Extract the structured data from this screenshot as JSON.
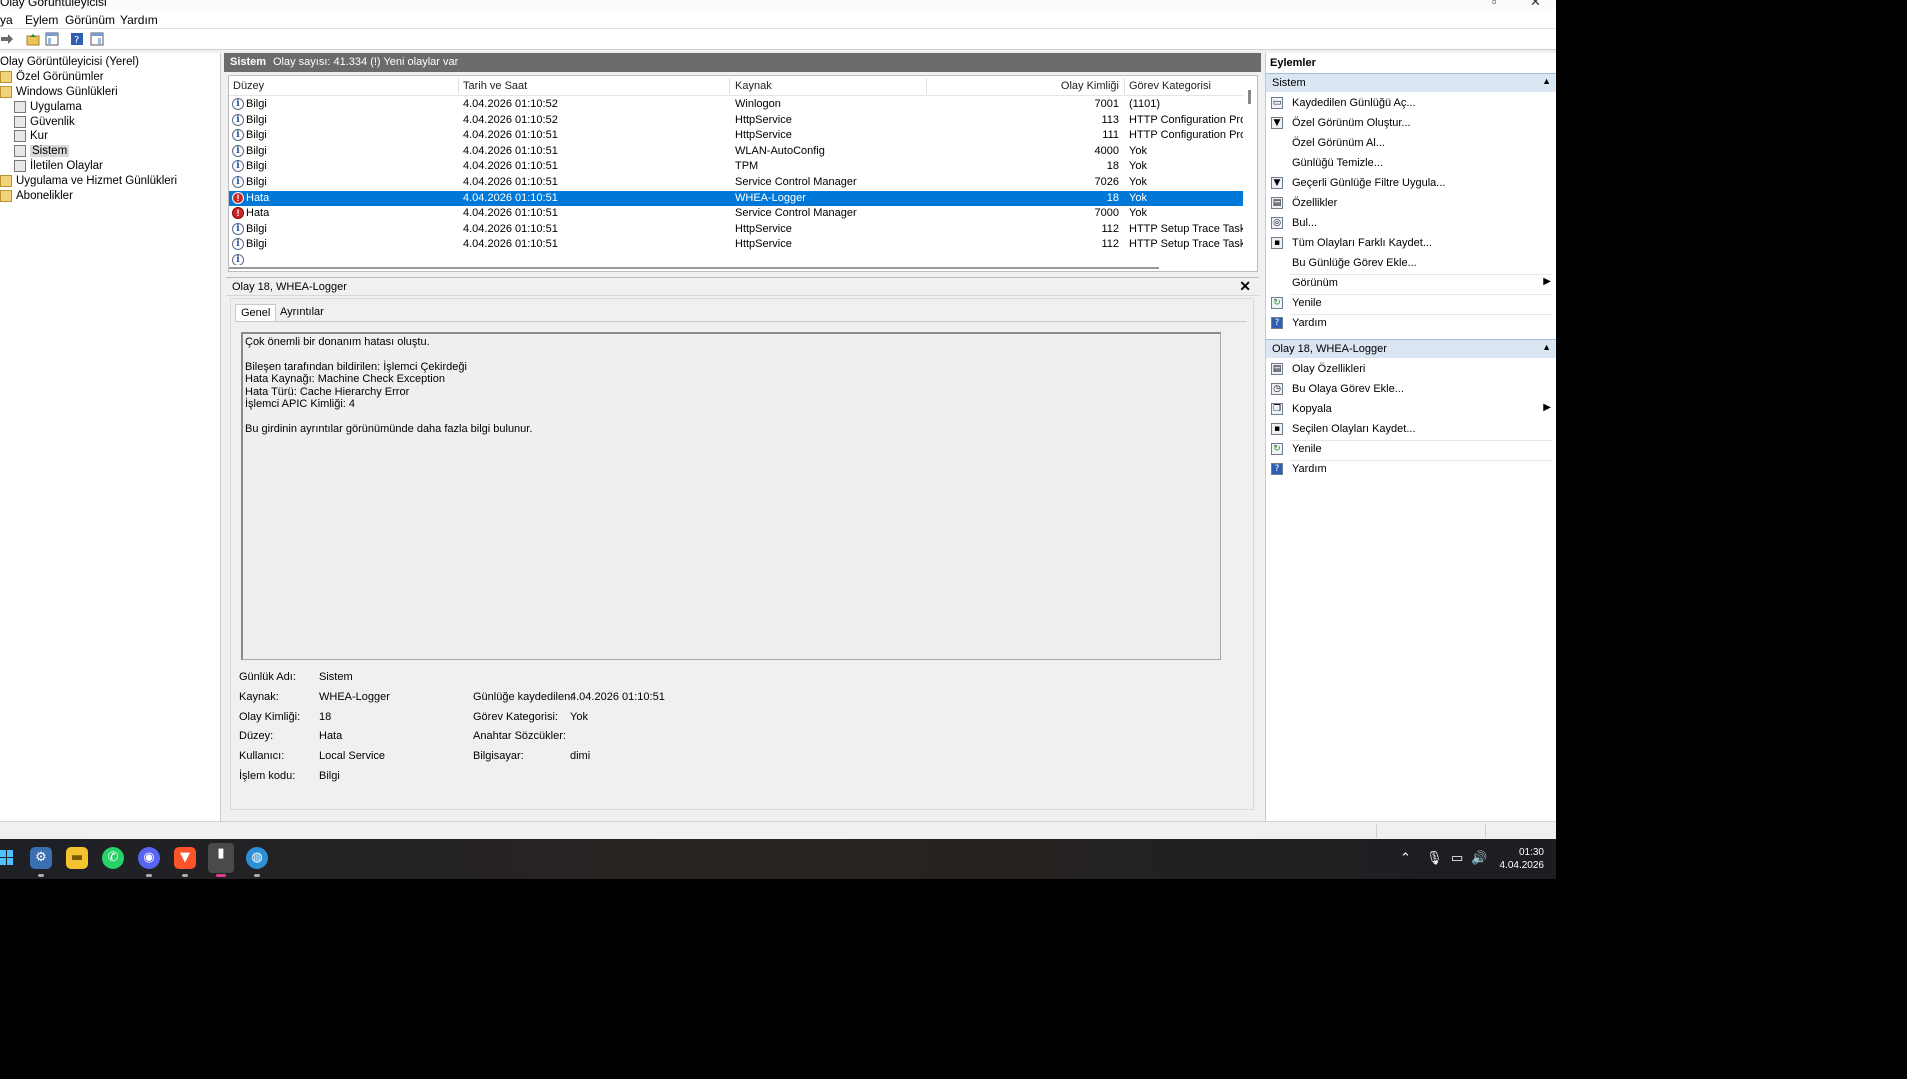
{
  "window": {
    "title": "Olay Görüntüleyicisi"
  },
  "menu": [
    "ya",
    "Eylem",
    "Görünüm",
    "Yardım"
  ],
  "tree": {
    "items": [
      {
        "label": "Olay Görüntüleyicisi (Yerel)"
      },
      {
        "label": "Özel Görünümler"
      },
      {
        "label": "Windows Günlükleri"
      },
      {
        "label": "Uygulama"
      },
      {
        "label": "Güvenlik"
      },
      {
        "label": "Kur"
      },
      {
        "label": "Sistem"
      },
      {
        "label": "İletilen Olaylar"
      },
      {
        "label": "Uygulama ve Hizmet Günlükleri"
      },
      {
        "label": "Abonelikler"
      }
    ],
    "selected": "Sistem"
  },
  "center": {
    "header_name": "Sistem",
    "header_info": "Olay sayısı: 41.334 (!) Yeni olaylar var",
    "columns": [
      "Düzey",
      "Tarih ve Saat",
      "Kaynak",
      "Olay Kimliği",
      "Görev Kategorisi"
    ],
    "rows": [
      {
        "level": "Bilgi",
        "type": "info",
        "date": "4.04.2026 01:10:52",
        "source": "Winlogon",
        "id": "7001",
        "category": "(1101)"
      },
      {
        "level": "Bilgi",
        "type": "info",
        "date": "4.04.2026 01:10:52",
        "source": "HttpService",
        "id": "113",
        "category": "HTTP Configuration Prope"
      },
      {
        "level": "Bilgi",
        "type": "info",
        "date": "4.04.2026 01:10:51",
        "source": "HttpService",
        "id": "111",
        "category": "HTTP Configuration Prope"
      },
      {
        "level": "Bilgi",
        "type": "info",
        "date": "4.04.2026 01:10:51",
        "source": "WLAN-AutoConfig",
        "id": "4000",
        "category": "Yok"
      },
      {
        "level": "Bilgi",
        "type": "info",
        "date": "4.04.2026 01:10:51",
        "source": "TPM",
        "id": "18",
        "category": "Yok"
      },
      {
        "level": "Bilgi",
        "type": "info",
        "date": "4.04.2026 01:10:51",
        "source": "Service Control Manager",
        "id": "7026",
        "category": "Yok"
      },
      {
        "level": "Hata",
        "type": "error",
        "date": "4.04.2026 01:10:51",
        "source": "WHEA-Logger",
        "id": "18",
        "category": "Yok",
        "selected": true
      },
      {
        "level": "Hata",
        "type": "error",
        "date": "4.04.2026 01:10:51",
        "source": "Service Control Manager",
        "id": "7000",
        "category": "Yok"
      },
      {
        "level": "Bilgi",
        "type": "info",
        "date": "4.04.2026 01:10:51",
        "source": "HttpService",
        "id": "112",
        "category": "HTTP Setup Trace Task"
      },
      {
        "level": "Bilgi",
        "type": "info",
        "date": "4.04.2026 01:10:51",
        "source": "HttpService",
        "id": "112",
        "category": "HTTP Setup Trace Task"
      }
    ]
  },
  "detail": {
    "title": "Olay 18, WHEA-Logger",
    "close": "✕",
    "tabs": [
      "Genel",
      "Ayrıntılar"
    ],
    "description": [
      "Çok önemli bir donanım hatası oluştu.",
      "",
      "Bileşen tarafından bildirilen: İşlemci Çekirdeği",
      "Hata Kaynağı: Machine Check Exception",
      "Hata Türü: Cache Hierarchy Error",
      "İşlemci APIC Kimliği: 4",
      "",
      "Bu girdinin ayrıntılar görünümünde daha fazla bilgi bulunur."
    ],
    "fields_left": [
      {
        "k": "Günlük Adı:",
        "v": "Sistem"
      },
      {
        "k": "Kaynak:",
        "v": "WHEA-Logger"
      },
      {
        "k": "Olay Kimliği:",
        "v": "18"
      },
      {
        "k": "Düzey:",
        "v": "Hata"
      },
      {
        "k": "Kullanıcı:",
        "v": "Local Service"
      },
      {
        "k": "İşlem kodu:",
        "v": "Bilgi"
      }
    ],
    "fields_right": [
      {
        "k": "Günlüğe kaydedilen:",
        "v": "4.04.2026 01:10:51"
      },
      {
        "k": "Görev Kategorisi:",
        "v": "Yok"
      },
      {
        "k": "Anahtar Sözcükler:",
        "v": ""
      },
      {
        "k": "Bilgisayar:",
        "v": "dimi"
      }
    ]
  },
  "actions": {
    "title": "Eylemler",
    "sections": [
      {
        "name": "Sistem",
        "items": [
          {
            "label": "Kaydedilen Günlüğü Aç...",
            "icon": "open-log-icon"
          },
          {
            "label": "Özel Görünüm Oluştur...",
            "icon": "filter-icon"
          },
          {
            "label": "Özel Görünüm Al...",
            "icon": ""
          },
          {
            "label": "Günlüğü Temizle...",
            "icon": ""
          },
          {
            "label": "Geçerli Günlüğe Filtre Uygula...",
            "icon": "filter-icon"
          },
          {
            "label": "Özellikler",
            "icon": "properties-icon"
          },
          {
            "label": "Bul...",
            "icon": "binoculars-icon"
          },
          {
            "label": "Tüm Olayları Farklı Kaydet...",
            "icon": "save-icon"
          },
          {
            "label": "Bu Günlüğe Görev Ekle...",
            "icon": ""
          },
          {
            "label": "Görünüm",
            "icon": "",
            "submenu": true
          },
          {
            "label": "Yenile",
            "icon": "refresh-icon"
          },
          {
            "label": "Yardım",
            "icon": "help-icon"
          }
        ]
      },
      {
        "name": "Olay 18, WHEA-Logger",
        "items": [
          {
            "label": "Olay Özellikleri",
            "icon": "properties-icon"
          },
          {
            "label": "Bu Olaya Görev Ekle...",
            "icon": "task-icon"
          },
          {
            "label": "Kopyala",
            "icon": "copy-icon",
            "submenu": true
          },
          {
            "label": "Seçilen Olayları Kaydet...",
            "icon": "save-icon"
          },
          {
            "label": "Yenile",
            "icon": "refresh-icon"
          },
          {
            "label": "Yardım",
            "icon": "help-icon"
          }
        ]
      }
    ]
  },
  "taskbar": {
    "time": "01:30",
    "date": "4.04.2026"
  },
  "colors": {
    "selection": "#0078d7",
    "section_header": "#dbe6f3",
    "center_header": "#6b6b6b"
  }
}
